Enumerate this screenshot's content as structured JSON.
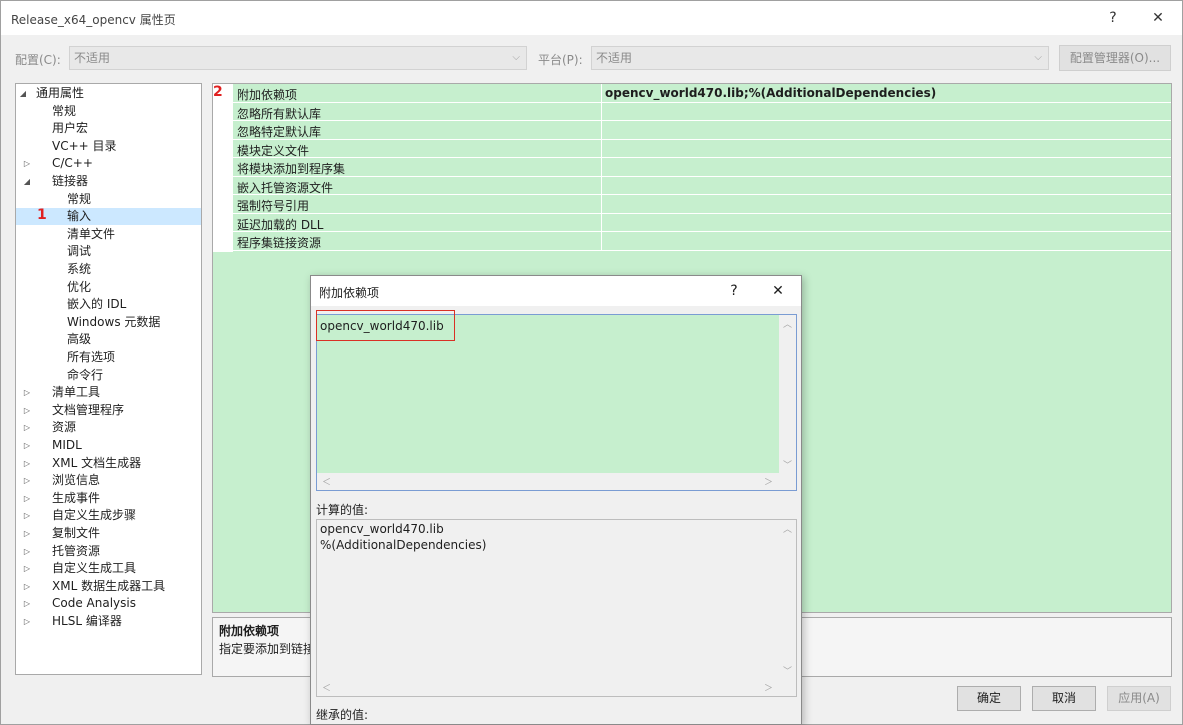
{
  "window": {
    "title": "Release_x64_opencv 属性页",
    "help_icon": "?",
    "close_icon": "✕"
  },
  "config": {
    "config_label": "配置(C):",
    "config_value": "不适用",
    "platform_label": "平台(P):",
    "platform_value": "不适用",
    "manager_button": "配置管理器(O)..."
  },
  "tree": {
    "items": [
      {
        "label": "通用属性",
        "expander": "◢",
        "level": 0
      },
      {
        "label": "常规",
        "level": 1
      },
      {
        "label": "用户宏",
        "level": 1
      },
      {
        "label": "VC++ 目录",
        "level": 1
      },
      {
        "label": "C/C++",
        "expander": "▷",
        "level": 1
      },
      {
        "label": "链接器",
        "expander": "◢",
        "level": 1
      },
      {
        "label": "常规",
        "level": 2
      },
      {
        "label": "输入",
        "level": 2,
        "selected": true,
        "marker": "1"
      },
      {
        "label": "清单文件",
        "level": 2
      },
      {
        "label": "调试",
        "level": 2
      },
      {
        "label": "系统",
        "level": 2
      },
      {
        "label": "优化",
        "level": 2
      },
      {
        "label": "嵌入的 IDL",
        "level": 2
      },
      {
        "label": "Windows 元数据",
        "level": 2
      },
      {
        "label": "高级",
        "level": 2
      },
      {
        "label": "所有选项",
        "level": 2
      },
      {
        "label": "命令行",
        "level": 2
      },
      {
        "label": "清单工具",
        "expander": "▷",
        "level": 1
      },
      {
        "label": "文档管理程序",
        "expander": "▷",
        "level": 1
      },
      {
        "label": "资源",
        "expander": "▷",
        "level": 1
      },
      {
        "label": "MIDL",
        "expander": "▷",
        "level": 1
      },
      {
        "label": "XML 文档生成器",
        "expander": "▷",
        "level": 1
      },
      {
        "label": "浏览信息",
        "expander": "▷",
        "level": 1
      },
      {
        "label": "生成事件",
        "expander": "▷",
        "level": 1
      },
      {
        "label": "自定义生成步骤",
        "expander": "▷",
        "level": 1
      },
      {
        "label": "复制文件",
        "expander": "▷",
        "level": 1
      },
      {
        "label": "托管资源",
        "expander": "▷",
        "level": 1
      },
      {
        "label": "自定义生成工具",
        "expander": "▷",
        "level": 1
      },
      {
        "label": "XML 数据生成器工具",
        "expander": "▷",
        "level": 1
      },
      {
        "label": "Code Analysis",
        "expander": "▷",
        "level": 1
      },
      {
        "label": "HLSL 编译器",
        "expander": "▷",
        "level": 1
      }
    ]
  },
  "grid": {
    "marker": "2",
    "rows": [
      {
        "name": "附加依赖项",
        "value": "opencv_world470.lib;%(AdditionalDependencies)"
      },
      {
        "name": "忽略所有默认库",
        "value": ""
      },
      {
        "name": "忽略特定默认库",
        "value": ""
      },
      {
        "name": "模块定义文件",
        "value": ""
      },
      {
        "name": "将模块添加到程序集",
        "value": ""
      },
      {
        "name": "嵌入托管资源文件",
        "value": ""
      },
      {
        "name": "强制符号引用",
        "value": ""
      },
      {
        "name": "延迟加载的 DLL",
        "value": ""
      },
      {
        "name": "程序集链接资源",
        "value": ""
      }
    ]
  },
  "description": {
    "title": "附加依赖项",
    "text": "指定要添加到链接"
  },
  "buttons": {
    "ok": "确定",
    "cancel": "取消",
    "apply": "应用(A)"
  },
  "dialog": {
    "title": "附加依赖项",
    "help_icon": "?",
    "close_icon": "✕",
    "edit_value": "opencv_world470.lib",
    "computed_label": "计算的值:",
    "computed_lines": [
      "opencv_world470.lib",
      "%(AdditionalDependencies)"
    ],
    "inherited_label": "继承的值:"
  },
  "colors": {
    "highlight_green": "#c6efce",
    "selection_blue": "#cce8ff",
    "marker_red": "#e02020"
  }
}
